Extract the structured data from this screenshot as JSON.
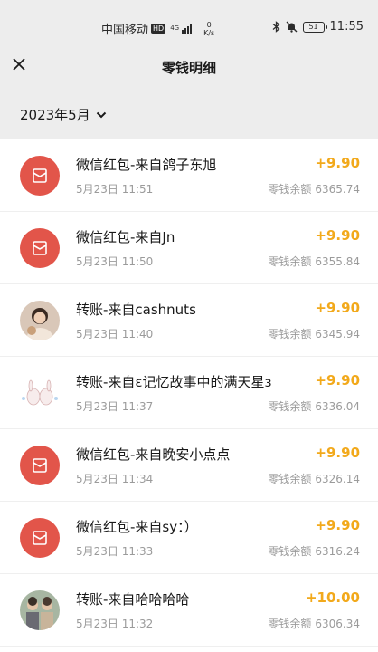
{
  "status_bar": {
    "carrier": "中国移动",
    "hd": "HD",
    "network": "4G",
    "speed_value": "0",
    "speed_unit": "K/s",
    "battery": "51",
    "time": "11:55"
  },
  "nav": {
    "close_icon": "close-icon",
    "title": "零钱明细"
  },
  "filter": {
    "month": "2023年5月",
    "dropdown_icon": "chevron-down-icon"
  },
  "balance_label": "零钱余额",
  "transactions": [
    {
      "type": "red-packet",
      "title": "微信红包-来自鸽子东旭",
      "time": "5月23日 11:51",
      "amount": "+9.90",
      "balance": "6365.74"
    },
    {
      "type": "red-packet",
      "title": "微信红包-来自Jn",
      "time": "5月23日 11:50",
      "amount": "+9.90",
      "balance": "6355.84"
    },
    {
      "type": "transfer",
      "title": "转账-来自cashnuts",
      "time": "5月23日 11:40",
      "amount": "+9.90",
      "balance": "6345.94"
    },
    {
      "type": "transfer",
      "title": "转账-来自ε记忆故事中的满天星з",
      "time": "5月23日 11:37",
      "amount": "+9.90",
      "balance": "6336.04"
    },
    {
      "type": "red-packet",
      "title": "微信红包-来自晚安小点点",
      "time": "5月23日 11:34",
      "amount": "+9.90",
      "balance": "6326.14"
    },
    {
      "type": "red-packet",
      "title": "微信红包-来自sy：）",
      "time": "5月23日 11:33",
      "amount": "+9.90",
      "balance": "6316.24"
    },
    {
      "type": "transfer",
      "title": "转账-来自哈哈哈哈",
      "time": "5月23日 11:32",
      "amount": "+10.00",
      "balance": "6306.34"
    }
  ],
  "colors": {
    "background": "#ededed",
    "red_packet": "#e2554a",
    "amount": "#f2a91b",
    "secondary_text": "#9b9b9b"
  }
}
